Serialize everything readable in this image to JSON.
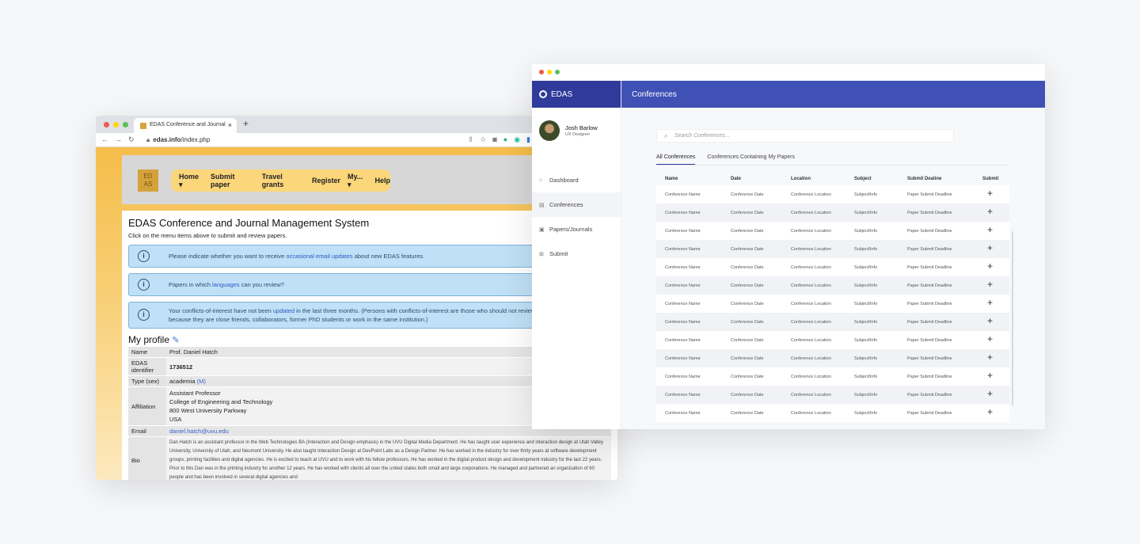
{
  "back_window": {
    "tab_title": "EDAS Conference and Journal",
    "url_domain": "edas.info",
    "url_path": "/index.php",
    "logo_text": [
      "ED",
      "AS"
    ],
    "menu": [
      "Home ▾",
      "Submit paper",
      "Travel grants",
      "Register",
      "My... ▾",
      "Help"
    ],
    "system_title": "EDAS Conference and Journal Management System",
    "system_subtitle": "Click on the menu items above to submit and review papers.",
    "alerts": [
      {
        "pre": "Please indicate whether you want to receive ",
        "link": "occasional email updates",
        "post": " about new EDAS features."
      },
      {
        "pre": "Papers in which ",
        "link": "languages",
        "post": " can you review?"
      },
      {
        "pre": "Your conflicts-of-interest have not been ",
        "link": "updated",
        "post": " in the last three months. (Persons with conflicts-of-interest are those who should not review papers of yours, e.g., because they are close friends, collaborators, former PhD students or work in the same institution.)"
      }
    ],
    "profile_heading": "My profile",
    "profile": {
      "name_key": "Name",
      "name_val": "Prof. Daniel Hatch",
      "id_key": "EDAS identifier",
      "id_val": "1736512",
      "type_key": "Type (sex)",
      "type_val": "academia",
      "type_sex": "(M)",
      "aff_key": "Affiliation",
      "aff_lines": [
        "Assistant Professor",
        "College of Engineering and Technology",
        "800 West University Parkway",
        "USA"
      ],
      "email_key": "Email",
      "email_val": "daniel.hatch@uvu.edu",
      "bio_key": "Bio",
      "bio_val": "Dan Hatch is an assistant professor in the Web Technologies BA (Interaction and Design emphasis) in the UVU Digital Media Department. He has taught user experience and interaction design at Utah Valley University, University of Utah, and Neumont University. He also taught Interaction Design at DevPoint Labs as a Design Partner. He has worked in the industry for over thirty years at software development groups, printing facilities and digital agencies. He is excited to teach at UVU and to work with his fellow professors. He has worked in the digital product design and development industry for the last 22 years. Prior to this Dan was in the printing industry for another 12 years. He has worked with clients all over the united states both small and large corporations. He managed and partnered an organization of 60 people and has been involved in several digital agencies and"
    }
  },
  "front_window": {
    "brand": "EDAS",
    "page_title": "Conferences",
    "user": {
      "name": "Josh Barlow",
      "role": "UX Designer"
    },
    "nav": [
      {
        "label": "Dashboard",
        "icon": "home-icon"
      },
      {
        "label": "Conferences",
        "icon": "list-icon"
      },
      {
        "label": "Papers/Journals",
        "icon": "document-icon"
      },
      {
        "label": "Submit",
        "icon": "add-box-icon"
      }
    ],
    "search_placeholder": "Search Conferences...",
    "tabs": [
      "All Conferences",
      "Conferences Containing My Papers"
    ],
    "columns": [
      "Name",
      "Date",
      "Location",
      "Subject",
      "Submit Dealine",
      "Submit"
    ],
    "row": {
      "name": "Conference Name",
      "date": "Conference Date",
      "location": "Conference Location",
      "subject": "Subject/Info",
      "deadline": "Paper Submit Deadline"
    },
    "row_count": 13
  }
}
